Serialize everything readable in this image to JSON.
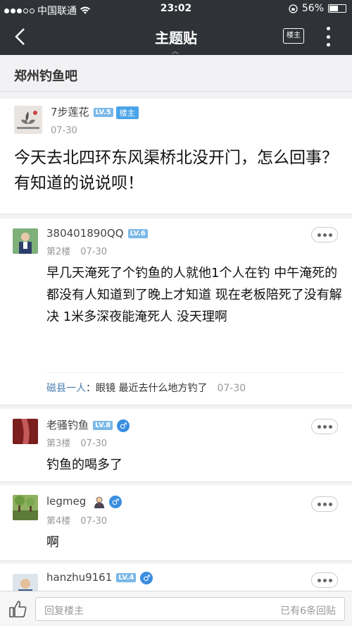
{
  "status_bar": {
    "carrier": "中国联通",
    "time": "23:02",
    "battery": "56%"
  },
  "nav": {
    "title": "主题贴",
    "louzhu_button": "楼主"
  },
  "forum": {
    "name": "郑州钓鱼吧"
  },
  "op": {
    "username": "7步莲花",
    "level": "LV.5",
    "tag": "楼主",
    "date": "07-30",
    "content": "今天去北四环东风渠桥北没开门，怎么回事？有知道的说说呗！"
  },
  "replies": [
    {
      "username": "380401890QQ",
      "level": "LV.6",
      "floor": "第2楼",
      "date": "07-30",
      "content": "早几天淹死了个钓鱼的人就他1个人在钓 中午淹死的都没有人知道到了晚上才知道 现在老板陪死了没有解决 1米多深夜能淹死人 没天理啊",
      "sub_reply": {
        "user": "磁县一人",
        "text": "：眼镜 最近去什么地方钓了",
        "date": "07-30"
      }
    },
    {
      "username": "老骚钓鱼",
      "level": "LV.8",
      "gender": "♂",
      "floor": "第3楼",
      "date": "07-30",
      "content": "钓鱼的喝多了"
    },
    {
      "username": "legmeg",
      "gender": "♂",
      "floor": "第4楼",
      "date": "07-30",
      "content": "啊"
    },
    {
      "username": "hanzhu9161",
      "level": "LV.4",
      "gender": "♂"
    }
  ],
  "bottom": {
    "placeholder": "回复楼主",
    "count": "已有6条回贴"
  }
}
